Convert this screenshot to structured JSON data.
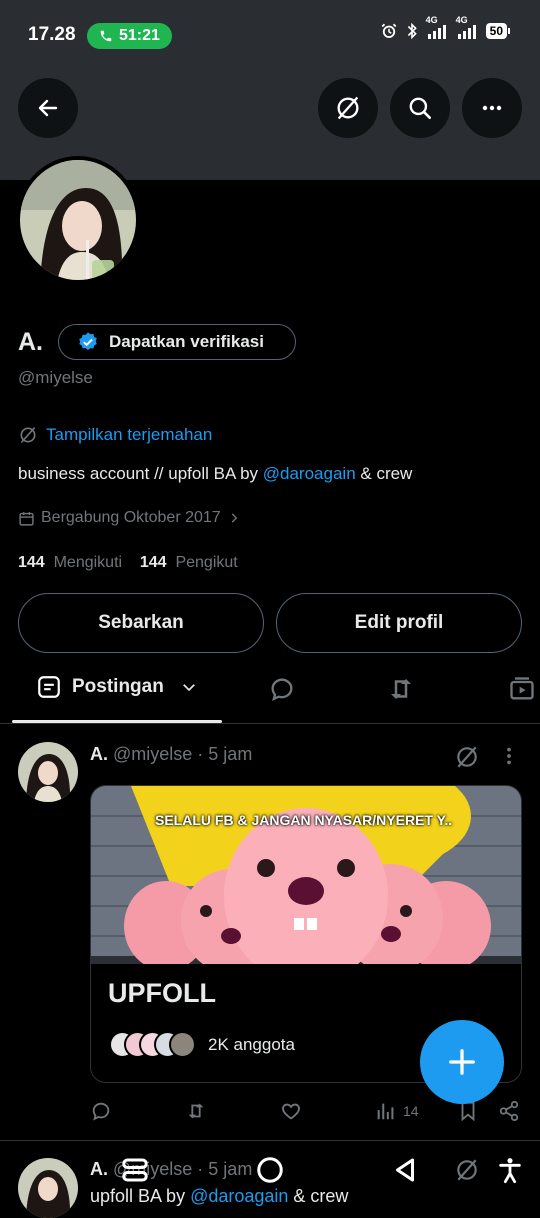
{
  "status_bar": {
    "time": "17.28",
    "call_timer": "51:21",
    "network_1": "4G",
    "network_2": "4G",
    "battery": "50"
  },
  "header": {
    "back_icon": "arrow-left-icon",
    "translate_icon": "translate-icon",
    "search_icon": "search-icon",
    "more_icon": "more-horizontal-icon"
  },
  "profile": {
    "name": "A.",
    "verify_label": "Dapatkan verifikasi",
    "handle": "@miyelse",
    "translate_label": "Tampilkan terjemahan",
    "bio_prefix": "business account // upfoll BA by ",
    "bio_link": "@daroagain",
    "bio_suffix": " & crew",
    "joined": "Bergabung Oktober 2017",
    "following_count": "144",
    "following_label": "Mengikuti",
    "followers_count": "144",
    "followers_label": "Pengikut",
    "share_button": "Sebarkan",
    "edit_button": "Edit profil"
  },
  "tabs": {
    "active_label": "Postingan"
  },
  "posts": [
    {
      "name": "A.",
      "meta": "@miyelse · 5 jam",
      "card": {
        "image_text": "SELALU FB & JANGAN NYASAR/NYERET Y..",
        "title": "UPFOLL",
        "members": "2K anggota"
      },
      "views": "14"
    },
    {
      "name": "A.",
      "meta": "@miyelse · 5 jam",
      "text_prefix": "upfoll BA by ",
      "text_link": "@daroagain",
      "text_suffix": " & crew"
    }
  ],
  "colors": {
    "accent": "#1d9bf0",
    "background": "#000000",
    "muted": "#71767b",
    "call_green": "#1fb652"
  }
}
